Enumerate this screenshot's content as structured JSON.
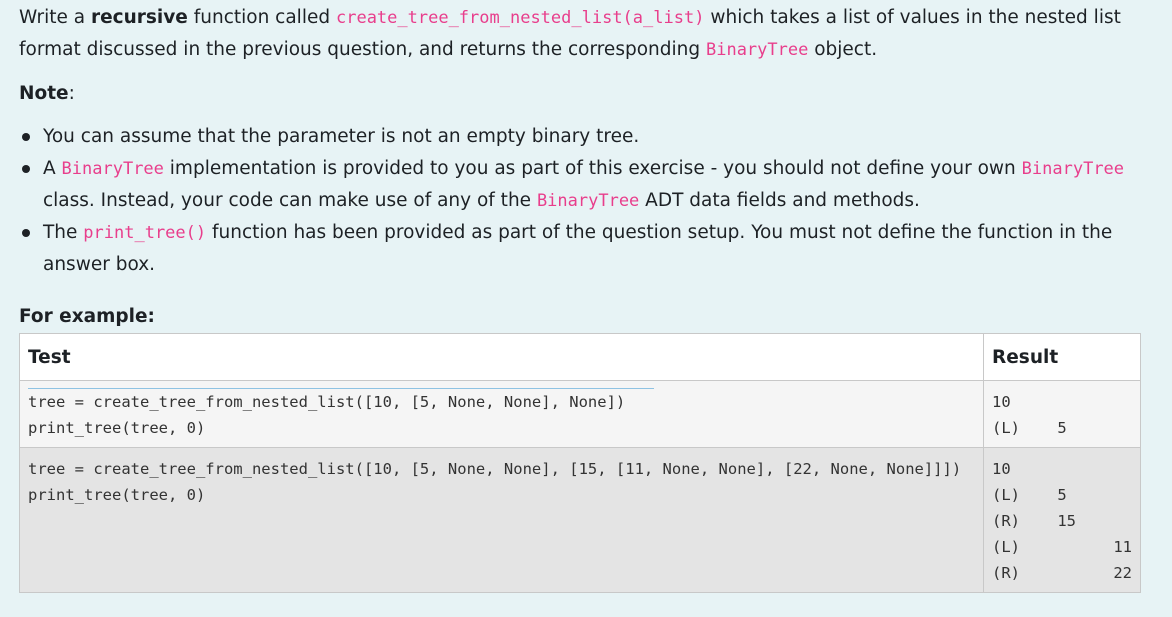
{
  "question": {
    "intro": {
      "t1": "Write a ",
      "t2": "recursive",
      "t3": " function called ",
      "fn": "create_tree_from_nested_list(a_list)",
      "t4": " which takes a list of values in the nested list format discussed in the previous question, and returns the corresponding ",
      "cls": "BinaryTree",
      "t5": " object."
    },
    "note_label": "Note",
    "note_colon": ":",
    "bullets": {
      "b1": "You can assume that the parameter is not an empty binary tree.",
      "b2_a": "A ",
      "b2_cls1": "BinaryTree",
      "b2_b": " implementation is provided to you as part of this exercise - you should not define your own ",
      "b2_cls2": "BinaryTree",
      "b2_c": " class. Instead, your code can make use of any of the ",
      "b2_cls3": "BinaryTree",
      "b2_d": " ADT data fields and methods.",
      "b3_a": "The ",
      "b3_fn": "print_tree()",
      "b3_b": " function has been provided as part of the question setup. You must not define the function in the answer box."
    },
    "for_example": "For example:"
  },
  "table": {
    "headers": {
      "test": "Test",
      "result": "Result"
    },
    "rows": [
      {
        "test_lines": [
          "tree = create_tree_from_nested_list([10, [5, None, None], None])",
          "print_tree(tree, 0)"
        ],
        "result_lines": [
          "10",
          "(L)    5"
        ]
      },
      {
        "test_lines": [
          "tree = create_tree_from_nested_list([10, [5, None, None], [15, [11, None, None], [22, None, None]]])",
          "print_tree(tree, 0)"
        ],
        "result_lines": [
          "10",
          "(L)    5",
          "(R)    15",
          "(L)          11",
          "(R)          22"
        ]
      }
    ]
  },
  "colors": {
    "background": "#e7f3f5",
    "code_accent": "#e83e8c",
    "row1_bg": "#f5f5f5",
    "row2_bg": "#e4e4e4"
  }
}
